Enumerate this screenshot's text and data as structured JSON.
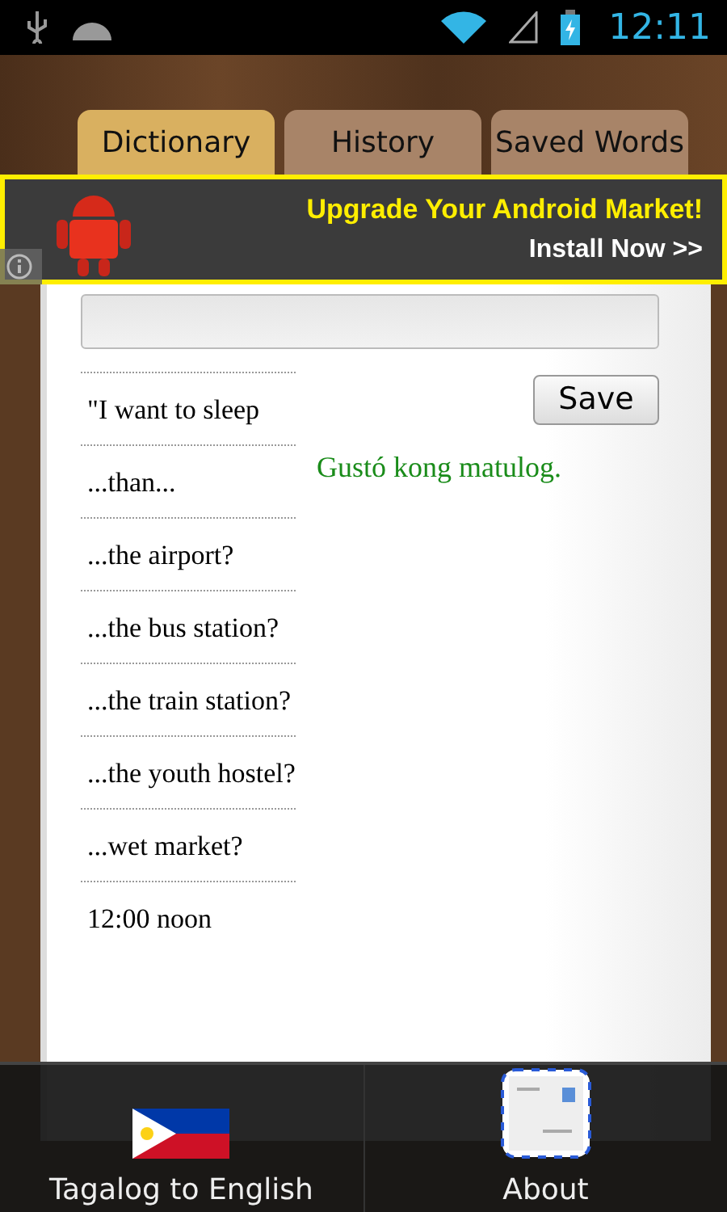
{
  "status_bar": {
    "time": "12:11"
  },
  "tabs": [
    {
      "label": "Dictionary",
      "selected": true
    },
    {
      "label": "History",
      "selected": false
    },
    {
      "label": "Saved Words",
      "selected": false
    }
  ],
  "ad": {
    "headline": "Upgrade Your Android Market!",
    "action": "Install Now >>"
  },
  "save_button": "Save",
  "phrases": [
    "\"I want to sleep",
    "...than...",
    "...the airport?",
    "...the bus station?",
    "...the train station?",
    "...the youth hostel?",
    "...wet market?",
    "12:00 noon"
  ],
  "translation": "Gustó kong matulog.",
  "bottom_menu": [
    {
      "label": "Tagalog to English",
      "kind": "flag"
    },
    {
      "label": "About",
      "kind": "mail"
    }
  ]
}
